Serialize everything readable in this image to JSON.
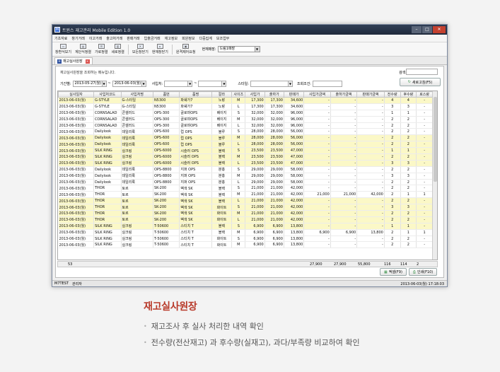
{
  "window": {
    "title": "트윈스 재고관리 Mobile Edition 1.0"
  },
  "menu": [
    "기초자료",
    "창기거래",
    "이고거래",
    "출고처거래",
    "판매거래",
    "입출금거래",
    "재고정보",
    "회원정보",
    "다중집계",
    "보조업무"
  ],
  "toolbar": {
    "buttons": [
      "창환식보기",
      "계단식정렬",
      "가로정렬",
      "세로정렬",
      "모든창닫기",
      "현재창닫기",
      "원격제어요청"
    ],
    "store_label": "현재매장:",
    "store_value": "드림1매장"
  },
  "tab": {
    "label": "재고실사원장"
  },
  "content": {
    "description": "재고실사원장을 조회하는 메뉴입니다.",
    "search_label": "검색:",
    "filters": {
      "period_label": "기간별:",
      "date_from": "2013-05-27(월)",
      "date_to": "2013-06-03(월)",
      "tilde": "~",
      "warehouse_label": "사입처:",
      "style_label": "스타일:",
      "condition_label": "조회조건:"
    },
    "refresh_label": "새로고침(F5)"
  },
  "grid": {
    "columns": [
      "실사일자",
      "사입처코드",
      "사입처명",
      "품번",
      "품명",
      "칼라",
      "사이즈",
      "사입가",
      "출하가",
      "판매가",
      "사입가금액",
      "출하가금액",
      "판매가금액",
      "전수량",
      "후수량",
      "로스량"
    ],
    "rows": [
      {
        "hl": true,
        "c": [
          "2013-06-03(월)",
          "G-STYLE",
          "G-스타일",
          "N5300",
          "파쉐가7",
          "노랑",
          "M",
          "17,300",
          "17,300",
          "34,600",
          "-",
          "-",
          "-",
          "4",
          "4",
          "-"
        ]
      },
      {
        "hl": false,
        "c": [
          "2013-06-03(월)",
          "G-STYLE",
          "G-스타일",
          "N5300",
          "파쉐가7",
          "노랑",
          "L",
          "17,300",
          "17,300",
          "34,600",
          "-",
          "-",
          "-",
          "3",
          "3",
          "-"
        ]
      },
      {
        "hl": false,
        "c": [
          "2013-06-03(월)",
          "CORNSALAD",
          "콘샐러드",
          "OPS-300",
          "골로먀OPS",
          "베이지",
          "S",
          "32,000",
          "32,000",
          "96,000",
          "-",
          "-",
          "-",
          "1",
          "1",
          "-"
        ]
      },
      {
        "hl": false,
        "c": [
          "2013-06-03(월)",
          "CORNSALAD",
          "콘샐러드",
          "OPS-300",
          "골로먀OPS",
          "베이지",
          "M",
          "32,000",
          "32,000",
          "96,000",
          "-",
          "-",
          "-",
          "2",
          "2",
          "-"
        ]
      },
      {
        "hl": false,
        "c": [
          "2013-06-03(월)",
          "CORNSALAD",
          "콘샐러드",
          "OPS-300",
          "골로먀OPS",
          "베이지",
          "L",
          "32,000",
          "32,000",
          "96,000",
          "-",
          "-",
          "-",
          "2",
          "2",
          "-"
        ]
      },
      {
        "hl": false,
        "c": [
          "2013-06-03(월)",
          "Dailylook",
          "데일리룩",
          "OPS-600",
          "럽 OPS",
          "블루",
          "S",
          "28,000",
          "28,000",
          "56,000",
          "-",
          "-",
          "-",
          "2",
          "2",
          "-"
        ]
      },
      {
        "hl": true,
        "c": [
          "2013-06-03(월)",
          "Dailylook",
          "데일리룩",
          "OPS-600",
          "럽 OPS",
          "블루",
          "M",
          "28,000",
          "28,000",
          "56,000",
          "-",
          "-",
          "-",
          "2",
          "2",
          "-"
        ]
      },
      {
        "hl": true,
        "c": [
          "2013-06-03(월)",
          "Dailylook",
          "데일리룩",
          "OPS-600",
          "럽 OPS",
          "블루",
          "L",
          "28,000",
          "28,000",
          "56,000",
          "-",
          "-",
          "-",
          "2",
          "2",
          "-"
        ]
      },
      {
        "hl": true,
        "c": [
          "2013-06-03(월)",
          "SILK RING",
          "실크링",
          "OPS-6000",
          "시슬러 OPS",
          "블랙",
          "S",
          "23,500",
          "23,500",
          "47,000",
          "-",
          "-",
          "-",
          "1",
          "1",
          "-"
        ]
      },
      {
        "hl": true,
        "c": [
          "2013-06-03(월)",
          "SILK RING",
          "실크링",
          "OPS-6000",
          "시슬러 OPS",
          "블랙",
          "M",
          "23,500",
          "23,500",
          "47,000",
          "-",
          "-",
          "-",
          "2",
          "2",
          "-"
        ]
      },
      {
        "hl": true,
        "c": [
          "2013-06-03(월)",
          "SILK RING",
          "실크링",
          "OPS-6000",
          "시슬러 OPS",
          "블랙",
          "L",
          "23,500",
          "23,500",
          "47,000",
          "-",
          "-",
          "-",
          "3",
          "3",
          "-"
        ]
      },
      {
        "hl": false,
        "c": [
          "2013-06-03(월)",
          "Dailylook",
          "데일리룩",
          "OPS-8800",
          "지퍼 OPS",
          "분홍",
          "S",
          "29,000",
          "29,000",
          "58,000",
          "-",
          "-",
          "-",
          "2",
          "2",
          "-"
        ]
      },
      {
        "hl": false,
        "c": [
          "2013-06-03(월)",
          "Dailylook",
          "데일리룩",
          "OPS-8800",
          "지퍼 OPS",
          "분홍",
          "M",
          "29,000",
          "29,000",
          "58,000",
          "-",
          "-",
          "-",
          "3",
          "3",
          "-"
        ]
      },
      {
        "hl": false,
        "c": [
          "2013-06-03(월)",
          "Dailylook",
          "데일리룩",
          "OPS-8800",
          "지퍼 OPS",
          "분홍",
          "L",
          "29,000",
          "29,000",
          "58,000",
          "-",
          "-",
          "-",
          "2",
          "2",
          "-"
        ]
      },
      {
        "hl": false,
        "c": [
          "2013-06-03(월)",
          "THOR",
          "토르",
          "SK-200",
          "벡색 SK",
          "블랙",
          "S",
          "21,000",
          "21,000",
          "42,000",
          "-",
          "-",
          "-",
          "2",
          "2",
          "-"
        ]
      },
      {
        "hl": false,
        "c": [
          "2013-06-03(월)",
          "THOR",
          "토르",
          "SK-200",
          "벡색 SK",
          "블랙",
          "M",
          "21,000",
          "21,000",
          "42,000",
          "21,000",
          "21,000",
          "42,000",
          "2",
          "1",
          "1"
        ]
      },
      {
        "hl": true,
        "c": [
          "2013-06-03(월)",
          "THOR",
          "토르",
          "SK-200",
          "벡색 SK",
          "블랙",
          "L",
          "21,000",
          "21,000",
          "42,000",
          "-",
          "-",
          "-",
          "2",
          "2",
          "-"
        ]
      },
      {
        "hl": true,
        "c": [
          "2013-06-03(월)",
          "THOR",
          "토르",
          "SK-200",
          "벡색 SK",
          "화이트",
          "S",
          "21,000",
          "21,000",
          "42,000",
          "-",
          "-",
          "-",
          "3",
          "3",
          "-"
        ]
      },
      {
        "hl": true,
        "c": [
          "2013-06-03(월)",
          "THOR",
          "토르",
          "SK-200",
          "벡색 SK",
          "화이트",
          "M",
          "21,000",
          "21,000",
          "42,000",
          "-",
          "-",
          "-",
          "2",
          "2",
          "-"
        ]
      },
      {
        "hl": true,
        "c": [
          "2013-06-03(월)",
          "THOR",
          "토르",
          "SK-200",
          "벡색 SK",
          "화이트",
          "L",
          "21,000",
          "21,000",
          "42,000",
          "-",
          "-",
          "-",
          "2",
          "2",
          "-"
        ]
      },
      {
        "hl": true,
        "c": [
          "2013-06-03(월)",
          "SILK RING",
          "실크링",
          "T-50600",
          "스티치 T",
          "블랙",
          "S",
          "6,900",
          "6,900",
          "13,800",
          "-",
          "-",
          "-",
          "1",
          "1",
          "-"
        ]
      },
      {
        "hl": false,
        "c": [
          "2013-06-03(월)",
          "SILK RING",
          "실크링",
          "T-50600",
          "스티치 T",
          "블랙",
          "M",
          "6,900",
          "6,900",
          "13,800",
          "6,900",
          "6,900",
          "13,800",
          "2",
          "1",
          "1"
        ]
      },
      {
        "hl": false,
        "c": [
          "2013-06-03(월)",
          "SILK RING",
          "실크링",
          "T-50600",
          "스티치 T",
          "화이트",
          "S",
          "6,900",
          "6,900",
          "13,800",
          "-",
          "-",
          "-",
          "2",
          "2",
          "-"
        ]
      },
      {
        "hl": false,
        "c": [
          "2013-06-03(월)",
          "SILK RING",
          "실크링",
          "T-50600",
          "스티치 T",
          "화이트",
          "M",
          "6,900",
          "6,900",
          "13,800",
          "-",
          "-",
          "-",
          "2",
          "2",
          "-"
        ]
      }
    ],
    "footer": {
      "count": "53",
      "purchase_amount": "27,900",
      "ship_amount": "27,900",
      "sale_amount": "55,800",
      "before_qty": "116",
      "after_qty": "114",
      "loss_qty": "2"
    }
  },
  "actions": {
    "excel_label": "엑셀(F9)",
    "print_label": "인쇄(F10)"
  },
  "statusbar": {
    "left": "M7TEST",
    "user": "관리자",
    "right": "2013-06-03(월) 17:18:03"
  },
  "caption": {
    "title": "재고실사원장",
    "items": [
      "재고조사 후 실사 처리한 내역 확인",
      "전수량(전산재고) 과 후수량(실재고), 과다/부족량 비교하여 확인"
    ]
  }
}
